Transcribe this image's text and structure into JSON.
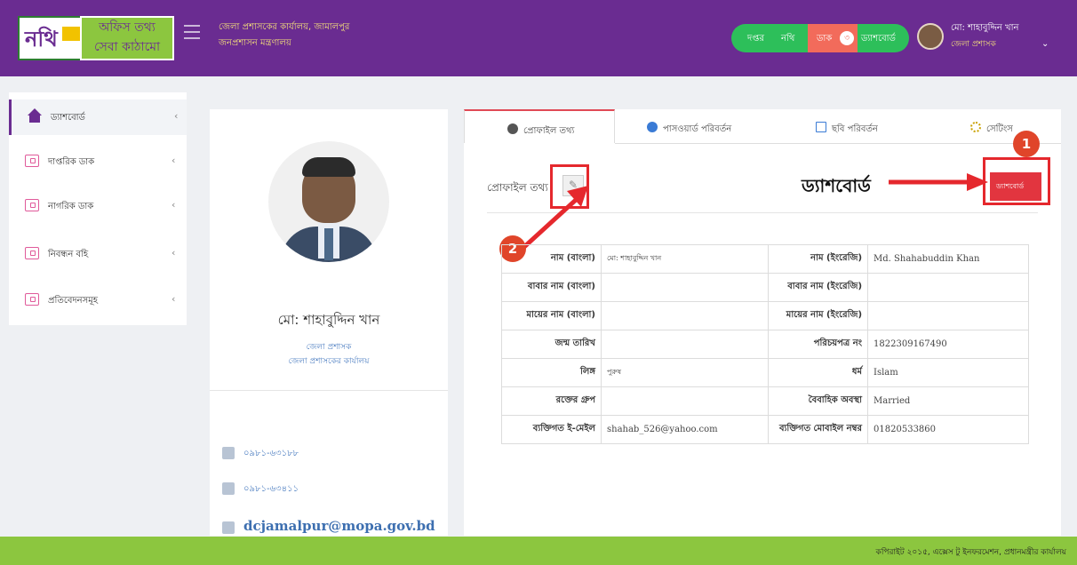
{
  "header": {
    "logo_nothi": "নথি",
    "logo_line1": "অফিস তথ্য",
    "logo_line2": "সেবা কাঠামো",
    "org_name": "জেলা প্রশাসকের কার্যালয়, জামালপুর",
    "ministry": "জনপ্রশাসন মন্ত্রণালয়",
    "nav": {
      "dashtor": "দপ্তর",
      "nothi": "নথি",
      "dak": "ডাক",
      "dak_count": "৩",
      "dashboard": "ড্যাশবোর্ড"
    },
    "user": {
      "name": "মো: শাহাবুদ্দিন খান",
      "designation": "জেলা প্রশাসক"
    }
  },
  "sidebar": {
    "items": [
      {
        "label": "ড্যাশবোর্ড",
        "icon": "home-icon"
      },
      {
        "label": "দাপ্তরিক ডাক",
        "icon": "briefcase-icon"
      },
      {
        "label": "নাগরিক ডাক",
        "icon": "briefcase-icon"
      },
      {
        "label": "নিবন্ধন বহি",
        "icon": "briefcase-icon"
      },
      {
        "label": "প্রতিবেদনসমূহ",
        "icon": "briefcase-icon"
      }
    ]
  },
  "profile": {
    "name": "মো: শাহাবুদ্দিন খান",
    "designation": "জেলা প্রশাসক",
    "office": "জেলা প্রশাসকের কার্যালয়",
    "phone": "০৯৮১-৬৩১৮৮",
    "fax": "০৯৮১-৬৩৪১১",
    "email": "dcjamalpur@mopa.gov.bd"
  },
  "tabs": [
    {
      "label": "প্রোফাইল তথ্য"
    },
    {
      "label": "পাসওয়ার্ড পরিবর্তন"
    },
    {
      "label": "ছবি পরিবর্তন"
    },
    {
      "label": "সেটিংস"
    }
  ],
  "content": {
    "title": "প্রোফাইল তথ্য",
    "dashboard_button": "ড্যাশবোর্ড",
    "annotation_label": "ড্যাশবোর্ড",
    "marker1": "1",
    "marker2": "2"
  },
  "table": {
    "rows": [
      {
        "l1": "নাম (বাংলা)",
        "v1": "মো: শাহাবুদ্দিন খান",
        "l2": "নাম (ইংরেজি)",
        "v2": "Md. Shahabuddin Khan"
      },
      {
        "l1": "বাবার নাম (বাংলা)",
        "v1": "",
        "l2": "বাবার নাম (ইংরেজি)",
        "v2": ""
      },
      {
        "l1": "মায়ের নাম (বাংলা)",
        "v1": "",
        "l2": "মায়ের নাম (ইংরেজি)",
        "v2": ""
      },
      {
        "l1": "জন্ম তারিখ",
        "v1": "",
        "l2": "পরিচয়পত্র নং",
        "v2": "1822309167490"
      },
      {
        "l1": "লিঙ্গ",
        "v1": "পুরুষ",
        "l2": "ধর্ম",
        "v2": "Islam"
      },
      {
        "l1": "রক্তের গ্রুপ",
        "v1": "",
        "l2": "বৈবাহিক অবস্থা",
        "v2": "Married"
      },
      {
        "l1": "ব্যক্তিগত ই-মেইল",
        "v1": "shahab_526@yahoo.com",
        "l2": "ব্যক্তিগত মোবাইল নম্বর",
        "v2": "01820533860"
      }
    ]
  },
  "footer": {
    "text": "কপিরাইট ২০১৫, এক্সেস টু ইনফরমেশন, প্রধানমন্ত্রীর কার্যালয়"
  },
  "colors": {
    "brand": "#6a2c91",
    "accent_green": "#8cc63f",
    "danger": "#e5282d"
  }
}
